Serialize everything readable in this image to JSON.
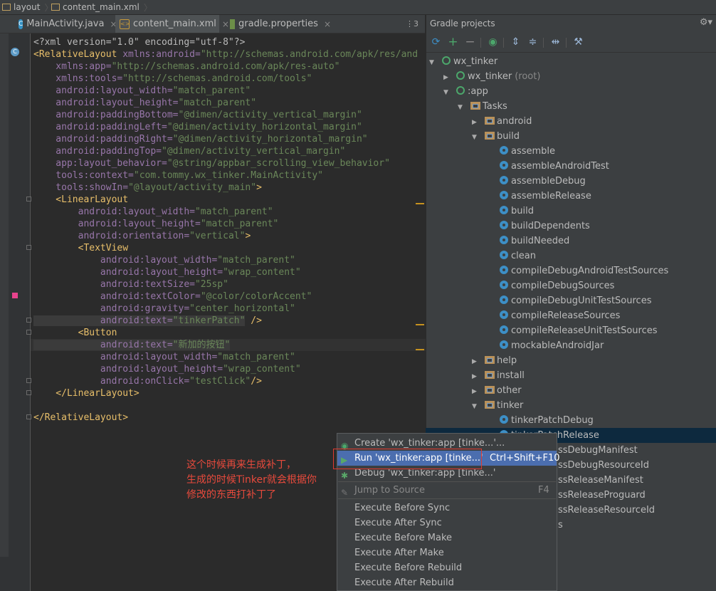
{
  "breadcrumb": {
    "items": [
      "layout",
      "content_main.xml"
    ]
  },
  "tabs": [
    {
      "label": "MainActivity.java",
      "icon": "class-c-icon"
    },
    {
      "label": "content_main.xml",
      "icon": "xml-file-icon"
    },
    {
      "label": "gradle.properties",
      "icon": "gradle-file-icon"
    }
  ],
  "tab_overflow": "⋮3",
  "editor": {
    "lines": [
      [
        "<?xml version=\"1.0\" encoding=\"utf-8\"?>"
      ],
      [
        "<RelativeLayout",
        " xmlns:android=",
        "\"http://schemas.android.com/apk/res/and"
      ],
      [
        "    xmlns:app=",
        "\"http://schemas.android.com/apk/res-auto\""
      ],
      [
        "    xmlns:tools=",
        "\"http://schemas.android.com/tools\""
      ],
      [
        "    android:layout_width=",
        "\"match_parent\""
      ],
      [
        "    android:layout_height=",
        "\"match_parent\""
      ],
      [
        "    android:paddingBottom=",
        "\"@dimen/activity_vertical_margin\""
      ],
      [
        "    android:paddingLeft=",
        "\"@dimen/activity_horizontal_margin\""
      ],
      [
        "    android:paddingRight=",
        "\"@dimen/activity_horizontal_margin\""
      ],
      [
        "    android:paddingTop=",
        "\"@dimen/activity_vertical_margin\""
      ],
      [
        "    app:layout_behavior=",
        "\"@string/appbar_scrolling_view_behavior\""
      ],
      [
        "    tools:context=",
        "\"com.tommy.wx_tinker.MainActivity\""
      ],
      [
        "    tools:showIn=",
        "\"@layout/activity_main\"",
        ">"
      ],
      [
        "    <LinearLayout"
      ],
      [
        "        android:layout_width=",
        "\"match_parent\""
      ],
      [
        "        android:layout_height=",
        "\"match_parent\""
      ],
      [
        "        android:orientation=",
        "\"vertical\"",
        ">"
      ],
      [
        "        <TextView"
      ],
      [
        "            android:layout_width=",
        "\"match_parent\""
      ],
      [
        "            android:layout_height=",
        "\"wrap_content\""
      ],
      [
        "            android:textSize=",
        "\"25sp\""
      ],
      [
        "            android:textColor=",
        "\"@color/colorAccent\""
      ],
      [
        "            android:gravity=",
        "\"center_horizontal\""
      ],
      [
        "            android:text=",
        "\"tinkerPatch\"",
        " />"
      ],
      [
        "        <Button"
      ],
      [
        "            android:text=",
        "\"新加的按钮\""
      ],
      [
        "            android:layout_width=",
        "\"match_parent\""
      ],
      [
        "            android:layout_height=",
        "\"wrap_content\""
      ],
      [
        "            android:onClick=",
        "\"testClick\"",
        "/>"
      ],
      [
        "    </LinearLayout>"
      ],
      [
        ""
      ],
      [
        "</RelativeLayout>"
      ]
    ]
  },
  "gradle": {
    "title": "Gradle projects",
    "tree": [
      {
        "label": "wx_tinker",
        "type": "gradle",
        "depth": 0,
        "expanded": true
      },
      {
        "label": "wx_tinker",
        "suffix": "(root)",
        "type": "gradle",
        "depth": 1,
        "expanded": false
      },
      {
        "label": ":app",
        "type": "gradle",
        "depth": 1,
        "expanded": true
      },
      {
        "label": "Tasks",
        "type": "folder",
        "depth": 2,
        "expanded": true
      },
      {
        "label": "android",
        "type": "folder",
        "depth": 3,
        "expanded": false
      },
      {
        "label": "build",
        "type": "folder",
        "depth": 3,
        "expanded": true
      },
      {
        "label": "assemble",
        "type": "task",
        "depth": 4
      },
      {
        "label": "assembleAndroidTest",
        "type": "task",
        "depth": 4
      },
      {
        "label": "assembleDebug",
        "type": "task",
        "depth": 4
      },
      {
        "label": "assembleRelease",
        "type": "task",
        "depth": 4
      },
      {
        "label": "build",
        "type": "task",
        "depth": 4
      },
      {
        "label": "buildDependents",
        "type": "task",
        "depth": 4
      },
      {
        "label": "buildNeeded",
        "type": "task",
        "depth": 4
      },
      {
        "label": "clean",
        "type": "task",
        "depth": 4
      },
      {
        "label": "compileDebugAndroidTestSources",
        "type": "task",
        "depth": 4
      },
      {
        "label": "compileDebugSources",
        "type": "task",
        "depth": 4
      },
      {
        "label": "compileDebugUnitTestSources",
        "type": "task",
        "depth": 4
      },
      {
        "label": "compileReleaseSources",
        "type": "task",
        "depth": 4
      },
      {
        "label": "compileReleaseUnitTestSources",
        "type": "task",
        "depth": 4
      },
      {
        "label": "mockableAndroidJar",
        "type": "task",
        "depth": 4
      },
      {
        "label": "help",
        "type": "folder",
        "depth": 3,
        "expanded": false
      },
      {
        "label": "install",
        "type": "folder",
        "depth": 3,
        "expanded": false
      },
      {
        "label": "other",
        "type": "folder",
        "depth": 3,
        "expanded": false
      },
      {
        "label": "tinker",
        "type": "folder",
        "depth": 3,
        "expanded": true
      },
      {
        "label": "tinkerPatchDebug",
        "type": "task",
        "depth": 4
      },
      {
        "label": "tinkerPatchRelease",
        "type": "task",
        "depth": 4,
        "selected": true
      }
    ],
    "partial_rows": [
      "ssDebugManifest",
      "ssDebugResourceId",
      "ssReleaseManifest",
      "ssReleaseProguard",
      "ssReleaseResourceId",
      "s"
    ]
  },
  "context_menu": {
    "items": [
      {
        "label": "Create 'wx_tinker:app [tinke...'...",
        "icon": "gradle-create-icon"
      },
      {
        "label": "Run 'wx_tinker:app [tinke...'",
        "shortcut": "Ctrl+Shift+F10",
        "icon": "run-icon",
        "selected": true
      },
      {
        "label": "Debug 'wx_tinker:app [tinke...'",
        "icon": "debug-icon"
      },
      {
        "label": "Jump to Source",
        "shortcut": "F4",
        "icon": "jump-to-source-icon",
        "disabled": true
      },
      {
        "label": "Execute Before Sync"
      },
      {
        "label": "Execute After Sync"
      },
      {
        "label": "Execute Before Make"
      },
      {
        "label": "Execute After Make"
      },
      {
        "label": "Execute Before Rebuild"
      },
      {
        "label": "Execute After Rebuild"
      }
    ]
  },
  "annotation": {
    "lines": [
      "这个时候再来生成补丁，",
      "生成的时候Tinker就会根据你",
      "修改的东西打补丁了"
    ],
    "color": "#e84a3c"
  }
}
